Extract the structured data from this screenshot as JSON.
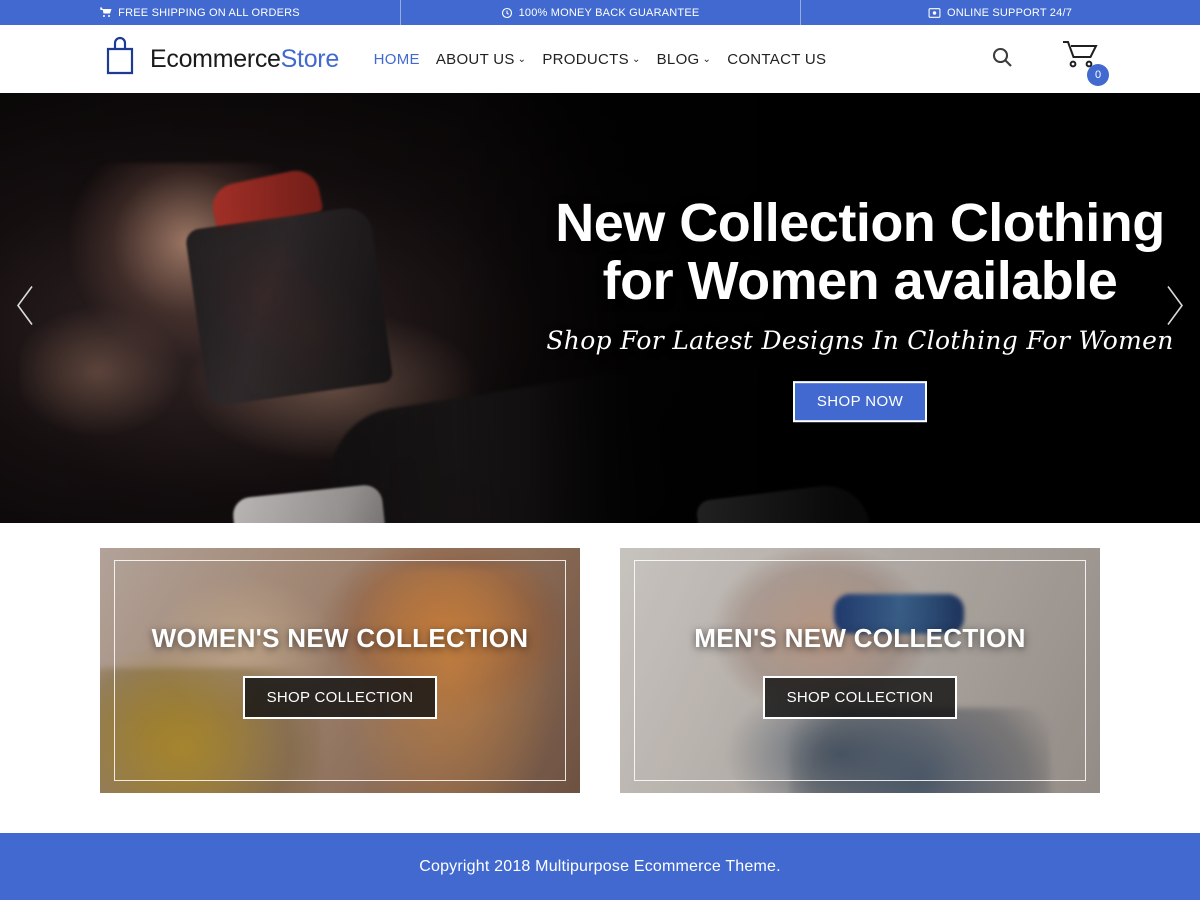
{
  "topbar": {
    "background": "#4169d0",
    "items": [
      {
        "icon": "shopping-cart-icon",
        "label": "FREE SHIPPING ON ALL ORDERS"
      },
      {
        "icon": "clock-icon",
        "label": "100% MONEY BACK GUARANTEE"
      },
      {
        "icon": "headset-support-icon",
        "label": "ONLINE SUPPORT 24/7"
      }
    ]
  },
  "header": {
    "logo": {
      "icon": "shopping-bag-icon",
      "text_primary": "Ecommerce",
      "text_accent": "Store",
      "accent_color": "#4169d0"
    },
    "nav": [
      {
        "label": "HOME",
        "caret": "",
        "active": true
      },
      {
        "label": "ABOUT US",
        "caret": "⌄",
        "active": false
      },
      {
        "label": "PRODUCTS",
        "caret": "⌄",
        "active": false
      },
      {
        "label": "BLOG",
        "caret": "⌄",
        "active": false
      },
      {
        "label": "CONTACT US",
        "caret": "",
        "active": false
      }
    ],
    "search": {
      "icon": "search-icon"
    },
    "cart": {
      "icon": "shopping-cart-icon",
      "count": "0",
      "badge_color": "#4169d0"
    }
  },
  "hero": {
    "title_line1": "New Collection Clothing",
    "title_line2": "for Women available",
    "subtitle": "Shop For Latest Designs In Clothing For Women",
    "cta": "SHOP NOW",
    "cta_color": "#4169d0",
    "prev_icon": "chevron-left-icon",
    "next_icon": "chevron-right-icon"
  },
  "promos": [
    {
      "title": "WOMEN'S NEW COLLECTION",
      "button": "SHOP COLLECTION"
    },
    {
      "title": "MEN'S NEW COLLECTION",
      "button": "SHOP COLLECTION"
    }
  ],
  "footer": {
    "copyright": "Copyright 2018 Multipurpose Ecommerce Theme.",
    "background": "#4169d0"
  }
}
